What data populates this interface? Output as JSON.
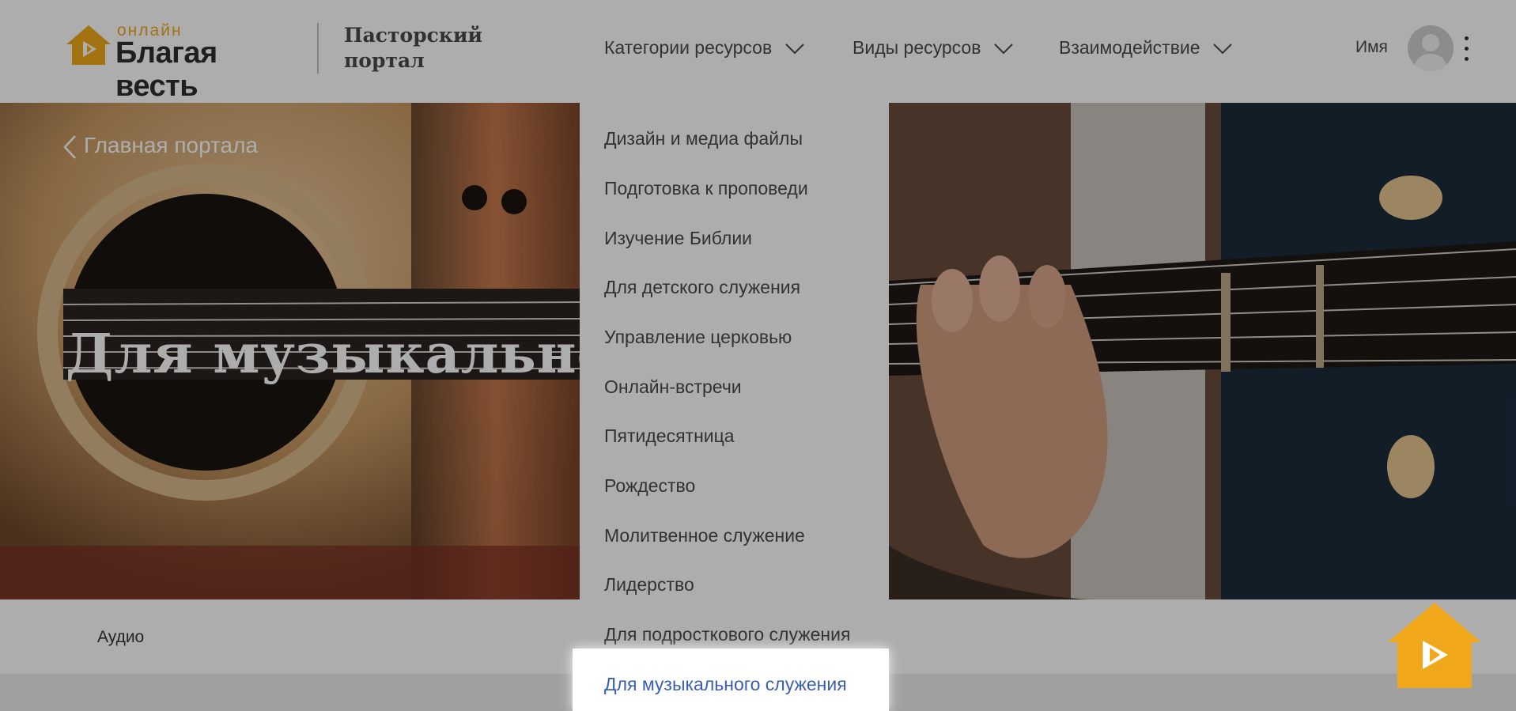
{
  "header": {
    "logo_small": "онлайн",
    "logo_big": "Благая весть",
    "portal_line1": "Пасторский",
    "portal_line2": "портал",
    "nav": [
      {
        "label": "Категории ресурсов"
      },
      {
        "label": "Виды ресурсов"
      },
      {
        "label": "Взаимодействие"
      }
    ],
    "user_name": "Имя"
  },
  "hero": {
    "back_link": "Главная портала",
    "title": "Для музыкального"
  },
  "tabs": {
    "audio": "Аудио"
  },
  "dropdown": {
    "items": [
      "Дизайн и медиа файлы",
      "Подготовка к проповеди",
      "Изучение Библии",
      "Для детского служения",
      "Управление церковью",
      "Онлайн-встречи",
      "Пятидесятница",
      "Рождество",
      "Молитвенное служение",
      "Лидерство",
      "Для подросткового служения"
    ],
    "active_item": "Для музыкального служения"
  },
  "colors": {
    "brand_orange": "#f0a81a",
    "link_blue": "#3a5fb0",
    "overlay": "rgba(0,0,0,0.32)"
  },
  "icons": [
    "home-play-logo-icon",
    "chevron-down-icon",
    "avatar-icon",
    "kebab-menu-icon",
    "chevron-left-icon",
    "play-house-button-icon"
  ]
}
